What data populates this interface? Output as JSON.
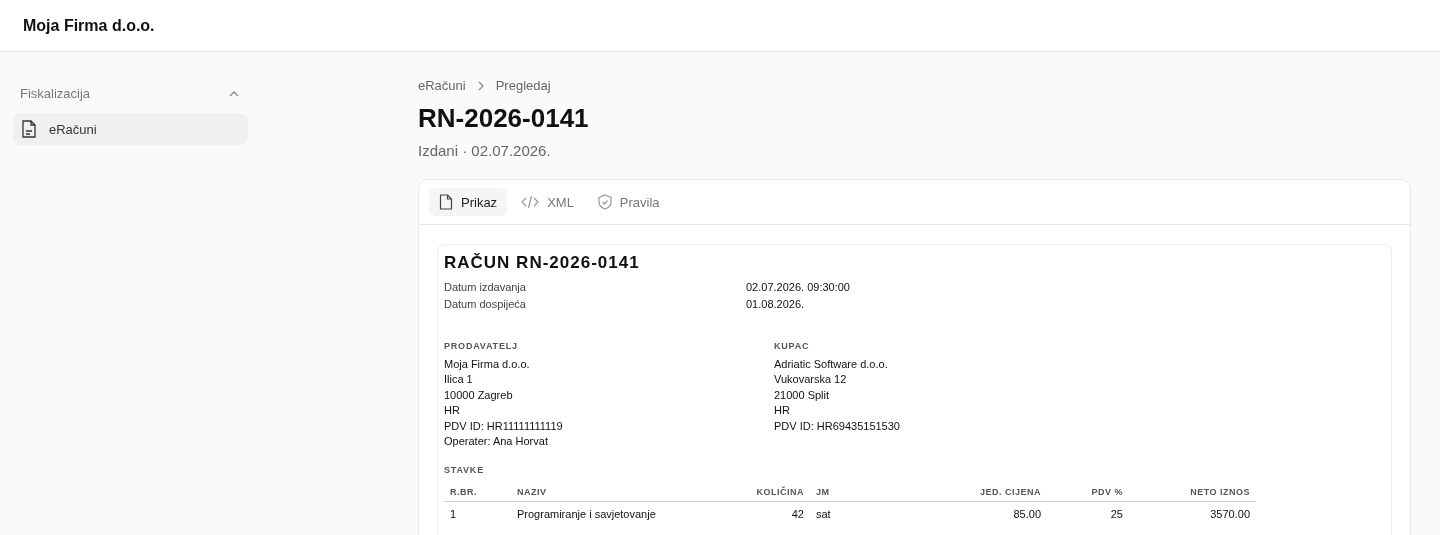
{
  "header": {
    "company": "Moja Firma d.o.o."
  },
  "sidebar": {
    "section": {
      "label": "Fiskalizacija",
      "expanded": true
    },
    "items": [
      {
        "label": "eRačuni",
        "selected": true
      }
    ]
  },
  "breadcrumb": [
    "eRačuni",
    "Pregledaj"
  ],
  "title": "RN-2026-0141",
  "subtitle": "Izdani · 02.07.2026.",
  "tabs": [
    {
      "label": "Prikaz",
      "selected": true
    },
    {
      "label": "XML",
      "selected": false
    },
    {
      "label": "Pravila",
      "selected": false
    }
  ],
  "invoice": {
    "title": "RAČUN RN-2026-0141",
    "dates": [
      {
        "label": "Datum izdavanja",
        "value": "02.07.2026. 09:30:00"
      },
      {
        "label": "Datum dospijeća",
        "value": "01.08.2026."
      }
    ],
    "parties": [
      {
        "heading": "PRODAVATELJ",
        "lines": [
          "Moja Firma d.o.o.",
          "Ilica 1",
          "10000 Zagreb",
          "HR",
          "PDV ID: HR11111111119",
          "Operater: Ana Horvat"
        ]
      },
      {
        "heading": "KUPAC",
        "lines": [
          "Adriatic Software d.o.o.",
          "Vukovarska 12",
          "21000 Split",
          "HR",
          "PDV ID: HR69435151530"
        ]
      }
    ],
    "items_heading": "STAVKE",
    "columns": [
      "R.BR.",
      "NAZIV",
      "KOLIČINA",
      "JM",
      "JED. CIJENA",
      "PDV %",
      "NETO IZNOS"
    ],
    "rows": [
      [
        "1",
        "Programiranje i savjetovanje",
        "42",
        "sat",
        "85.00",
        "25",
        "3570.00"
      ]
    ]
  }
}
